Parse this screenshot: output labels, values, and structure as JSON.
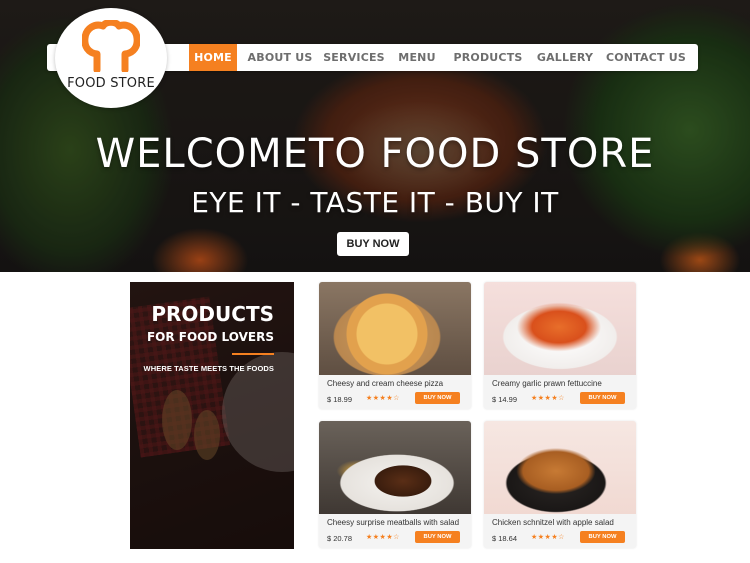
{
  "brand": {
    "logo_text": "FOOD STORE",
    "accent_color": "#f58020"
  },
  "nav": {
    "items": [
      {
        "label": "HOME",
        "active": true
      },
      {
        "label": "ABOUT US",
        "active": false
      },
      {
        "label": "SERVICES",
        "active": false
      },
      {
        "label": "MENU",
        "active": false
      },
      {
        "label": "PRODUCTS",
        "active": false
      },
      {
        "label": "GALLERY",
        "active": false
      },
      {
        "label": "CONTACT US",
        "active": false
      }
    ]
  },
  "hero": {
    "title": "WELCOMETO FOOD STORE",
    "subtitle": "EYE IT - TASTE IT - BUY IT",
    "button_label": "BUY NOW"
  },
  "promo": {
    "title": "PRODUCTS",
    "subtitle": "FOR FOOD LOVERS",
    "tagline": "WHERE TASTE MEETS THE FOODS"
  },
  "products": [
    {
      "name": "Cheesy and cream cheese pizza",
      "price": "$ 18.99",
      "rating": 4,
      "rating_display": "★★★★☆",
      "button": "BUY NOW",
      "image_icon": "pizza"
    },
    {
      "name": "Creamy garlic prawn fettuccine",
      "price": "$ 14.99",
      "rating": 4,
      "rating_display": "★★★★☆",
      "button": "BUY NOW",
      "image_icon": "pasta"
    },
    {
      "name": "Cheesy surprise meatballs with salad",
      "price": "$ 20.78",
      "rating": 4,
      "rating_display": "★★★★☆",
      "button": "BUY NOW",
      "image_icon": "steak"
    },
    {
      "name": "Chicken schnitzel with apple salad",
      "price": "$ 18.64",
      "rating": 4,
      "rating_display": "★★★★☆",
      "button": "BUY NOW",
      "image_icon": "fried-chicken"
    }
  ]
}
